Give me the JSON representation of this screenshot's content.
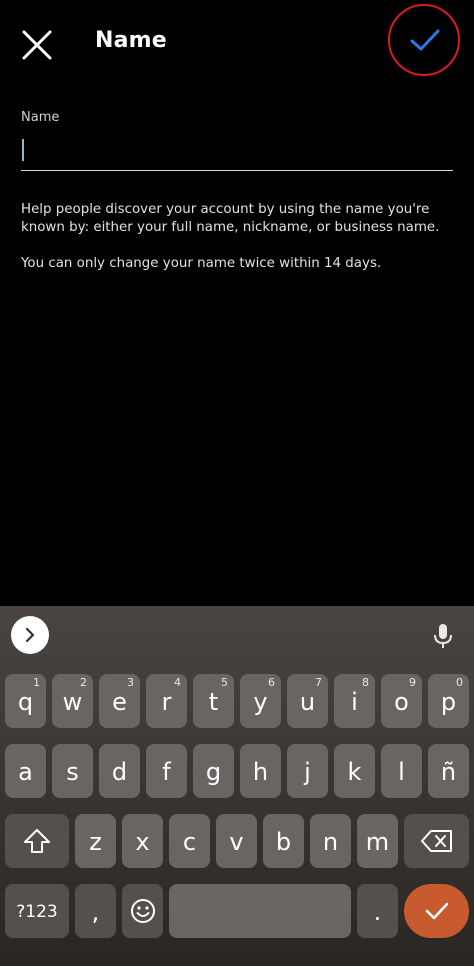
{
  "header": {
    "title": "Name",
    "close_icon": "close-icon",
    "done_icon": "checkmark-icon",
    "done_color": "#2a7be4",
    "highlight_color": "#d8192a"
  },
  "form": {
    "label": "Name",
    "value": "",
    "help_text_1": "Help people discover your account by using the name you're known by: either your full name, nickname, or business name.",
    "help_text_2": "You can only change your name twice within 14 days."
  },
  "keyboard": {
    "row1": [
      {
        "key": "q",
        "hint": "1"
      },
      {
        "key": "w",
        "hint": "2"
      },
      {
        "key": "e",
        "hint": "3"
      },
      {
        "key": "r",
        "hint": "4"
      },
      {
        "key": "t",
        "hint": "5"
      },
      {
        "key": "y",
        "hint": "6"
      },
      {
        "key": "u",
        "hint": "7"
      },
      {
        "key": "i",
        "hint": "8"
      },
      {
        "key": "o",
        "hint": "9"
      },
      {
        "key": "p",
        "hint": "0"
      }
    ],
    "row2": [
      "a",
      "s",
      "d",
      "f",
      "g",
      "h",
      "j",
      "k",
      "l",
      "ñ"
    ],
    "row3": [
      "z",
      "x",
      "c",
      "v",
      "b",
      "n",
      "m"
    ],
    "symbols_label": "?123",
    "comma_label": ",",
    "period_label": ".",
    "shift_icon": "shift-icon",
    "backspace_icon": "backspace-icon",
    "emoji_icon": "emoji-icon",
    "enter_icon": "checkmark-icon",
    "enter_color": "#c75a2f"
  }
}
